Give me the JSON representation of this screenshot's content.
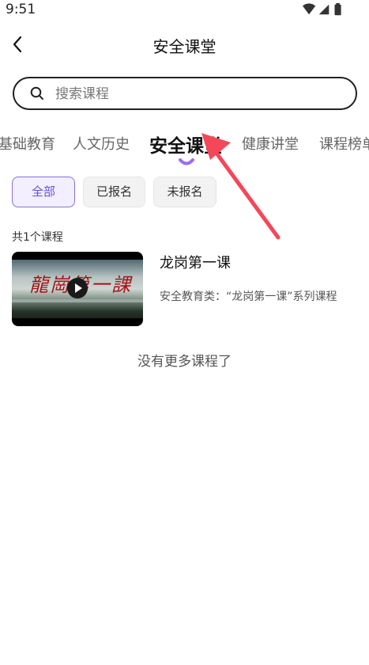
{
  "status_bar": {
    "time": "9:51"
  },
  "header": {
    "title": "安全课堂"
  },
  "search": {
    "placeholder": "搜索课程"
  },
  "tabs": [
    {
      "label": "基础教育"
    },
    {
      "label": "人文历史"
    },
    {
      "label": "安全课堂",
      "active": true
    },
    {
      "label": "健康讲堂"
    },
    {
      "label": "课程榜单"
    }
  ],
  "filters": [
    {
      "label": "全部",
      "selected": true
    },
    {
      "label": "已报名"
    },
    {
      "label": "未报名"
    }
  ],
  "course_count": "共1个课程",
  "courses": [
    {
      "title": "龙岗第一课",
      "description": "安全教育类：“龙岗第一课”系列课程",
      "thumbnail_text": "龍崗第一課"
    }
  ],
  "footer": {
    "no_more": "没有更多课程了"
  },
  "colors": {
    "accent": "#6a4fd6",
    "tab_indicator": "#9b6cf0",
    "arrow_annotation": "#f4475a"
  }
}
